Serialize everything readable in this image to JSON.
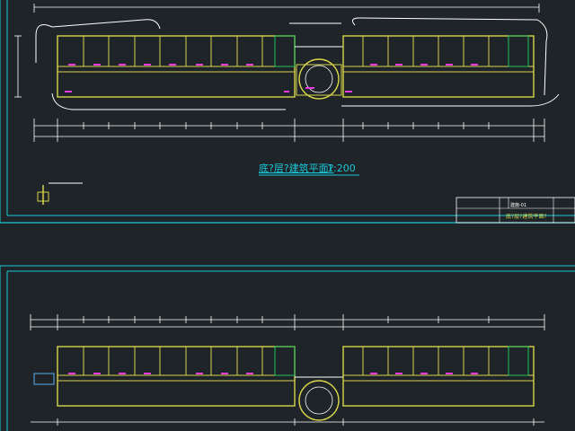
{
  "drawing": {
    "title": "底?层?建筑平面?",
    "scale": "1:200",
    "title_block": {
      "title": "底?层?建筑平面?",
      "code_top": "建施-01"
    }
  },
  "colors": {
    "background": "#1f2429",
    "walls": "#d8d44a",
    "lines": "#ffffff",
    "frame": "#19c8d8",
    "stair": "#22c55e",
    "fixture": "#e83adf",
    "title_text": "#19c8d8"
  }
}
